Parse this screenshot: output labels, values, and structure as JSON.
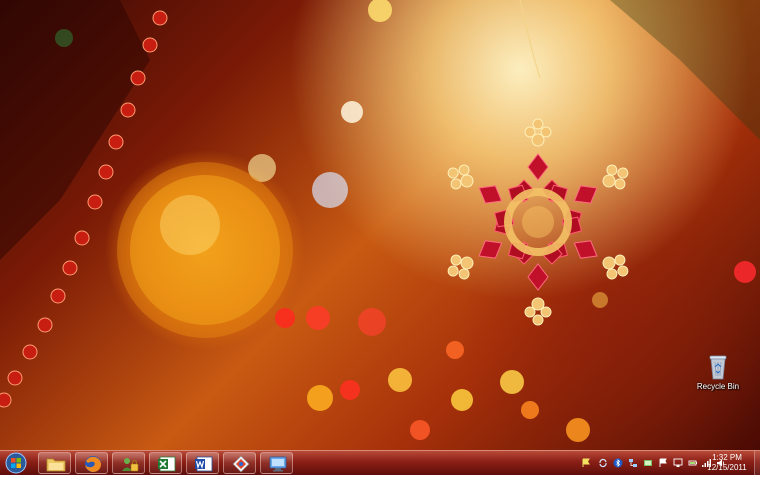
{
  "desktop": {
    "icons": [
      {
        "label": "Recycle Bin",
        "icon": "recycle-bin-icon"
      }
    ]
  },
  "taskbar": {
    "start_icon": "windows-orb-icon",
    "pinned": [
      {
        "name": "windows-explorer",
        "icon": "folder-icon"
      },
      {
        "name": "firefox",
        "icon": "firefox-icon"
      },
      {
        "name": "user-accounts",
        "icon": "users-lock-icon"
      },
      {
        "name": "excel",
        "icon": "excel-icon"
      },
      {
        "name": "word",
        "icon": "word-icon"
      },
      {
        "name": "app-diamond",
        "icon": "diamond-app-icon"
      },
      {
        "name": "remote-desktop",
        "icon": "monitor-icon"
      }
    ],
    "tray": {
      "icons": [
        "flag-icon",
        "sync-icon",
        "bluetooth-icon",
        "network-manager-icon",
        "update-icon",
        "action-center-icon",
        "display-icon",
        "battery-icon",
        "signal-icon",
        "volume-icon"
      ],
      "time": "1:32 PM",
      "date": "12/15/2011"
    }
  }
}
